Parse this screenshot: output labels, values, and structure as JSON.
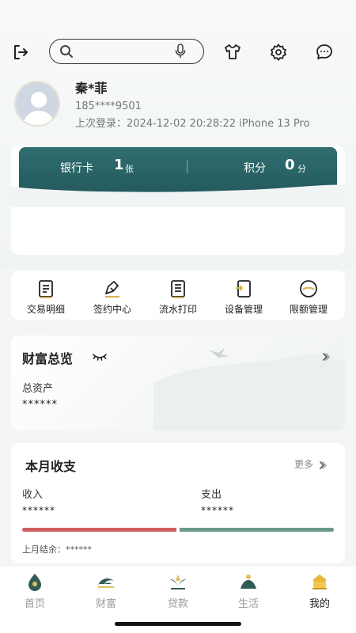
{
  "toolbar": {
    "search_placeholder": "",
    "icons": [
      "logout-icon",
      "search-icon",
      "microphone-icon",
      "tshirt-icon",
      "settings-icon",
      "message-icon"
    ]
  },
  "profile": {
    "name": "秦*菲",
    "phone": "185****9501",
    "last_login": "上次登录：2024-12-02 20:28:22 iPhone 13 Pro"
  },
  "card": {
    "bank_label": "银行卡",
    "bank_count": "1",
    "bank_unit": "张",
    "points_label": "积分",
    "points_count": "0",
    "points_unit": "分",
    "accent_color": "#2f6e70"
  },
  "quick_actions": [
    {
      "label": "交易明细",
      "icon": "transaction-list-icon"
    },
    {
      "label": "签约中心",
      "icon": "sign-pen-icon"
    },
    {
      "label": "流水打印",
      "icon": "print-doc-icon"
    },
    {
      "label": "设备管理",
      "icon": "device-icon"
    },
    {
      "label": "限额管理",
      "icon": "limit-gauge-icon"
    }
  ],
  "wealth": {
    "title": "财富总览",
    "assets_label": "总资产",
    "assets_value": "******"
  },
  "monthly": {
    "title": "本月收支",
    "more": "更多",
    "income_label": "收入",
    "income_value": "******",
    "expense_label": "支出",
    "expense_value": "******",
    "income_share": 0.5,
    "last_balance": "上月结余：******",
    "income_color": "#cd5f5c",
    "expense_color": "#6b9987"
  },
  "tabs": [
    {
      "label": "首页",
      "icon": "home-icon",
      "active": false
    },
    {
      "label": "财富",
      "icon": "wealth-icon",
      "active": false
    },
    {
      "label": "贷款",
      "icon": "loan-icon",
      "active": false
    },
    {
      "label": "生活",
      "icon": "life-icon",
      "active": false
    },
    {
      "label": "我的",
      "icon": "mine-icon",
      "active": true
    }
  ]
}
